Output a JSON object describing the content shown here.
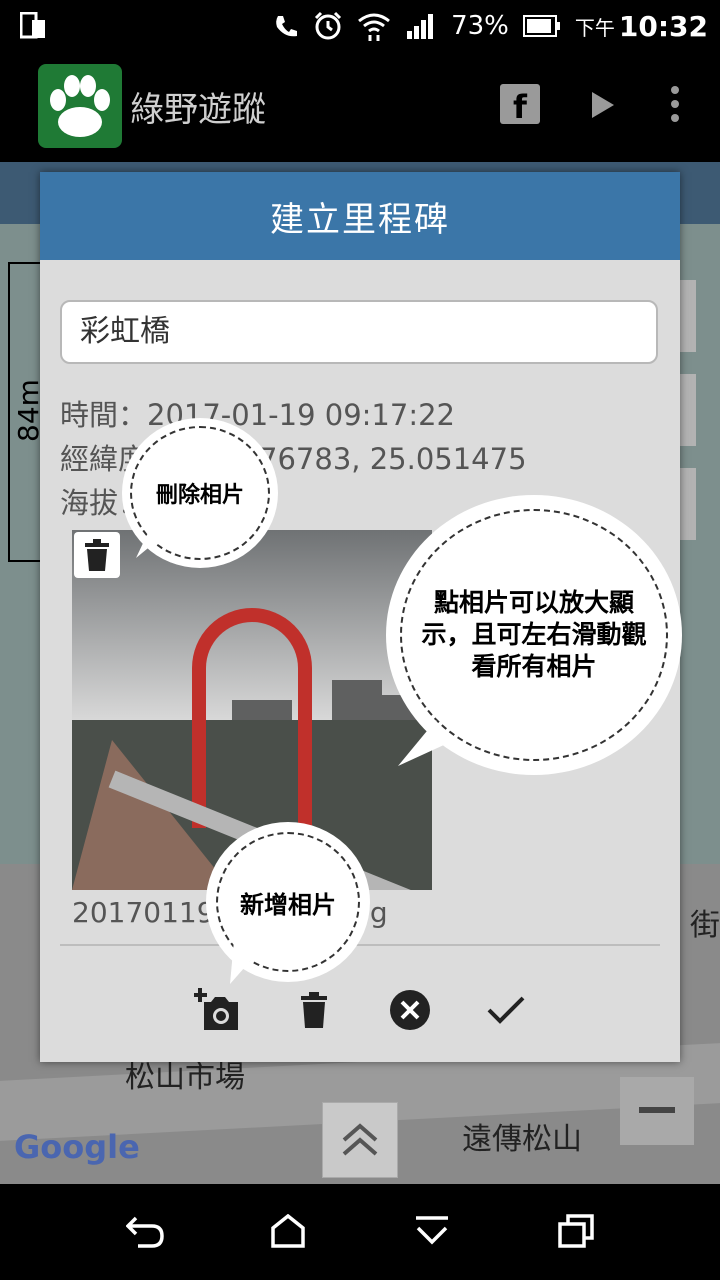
{
  "status_bar": {
    "battery": "73%",
    "ampm": "下午",
    "time": "10:32"
  },
  "app_bar": {
    "title": "綠野遊蹤"
  },
  "map": {
    "scale": "84m",
    "places": [
      "松山市場",
      "遠傳松山",
      "街"
    ],
    "google": "Google"
  },
  "dialog": {
    "title": "建立里程碑",
    "name_value": "彩虹橋",
    "info_lines": [
      "時間：2017-01-19 09:17:22",
      "經緯度：121.576783, 25.051475",
      "海拔："
    ],
    "filename": "20170119_091722.jpg"
  },
  "bubbles": {
    "delete": "刪除相片",
    "tap": "點相片可以放大顯示，且可左右滑動觀看所有相片",
    "add": "新增相片"
  },
  "icons": {
    "add_photo": "add-photo-icon",
    "delete": "trash-icon",
    "cancel": "cancel-icon",
    "confirm": "check-icon"
  },
  "colors": {
    "dialog_header": "#3b76a8",
    "app_logo": "#1f7a35"
  }
}
